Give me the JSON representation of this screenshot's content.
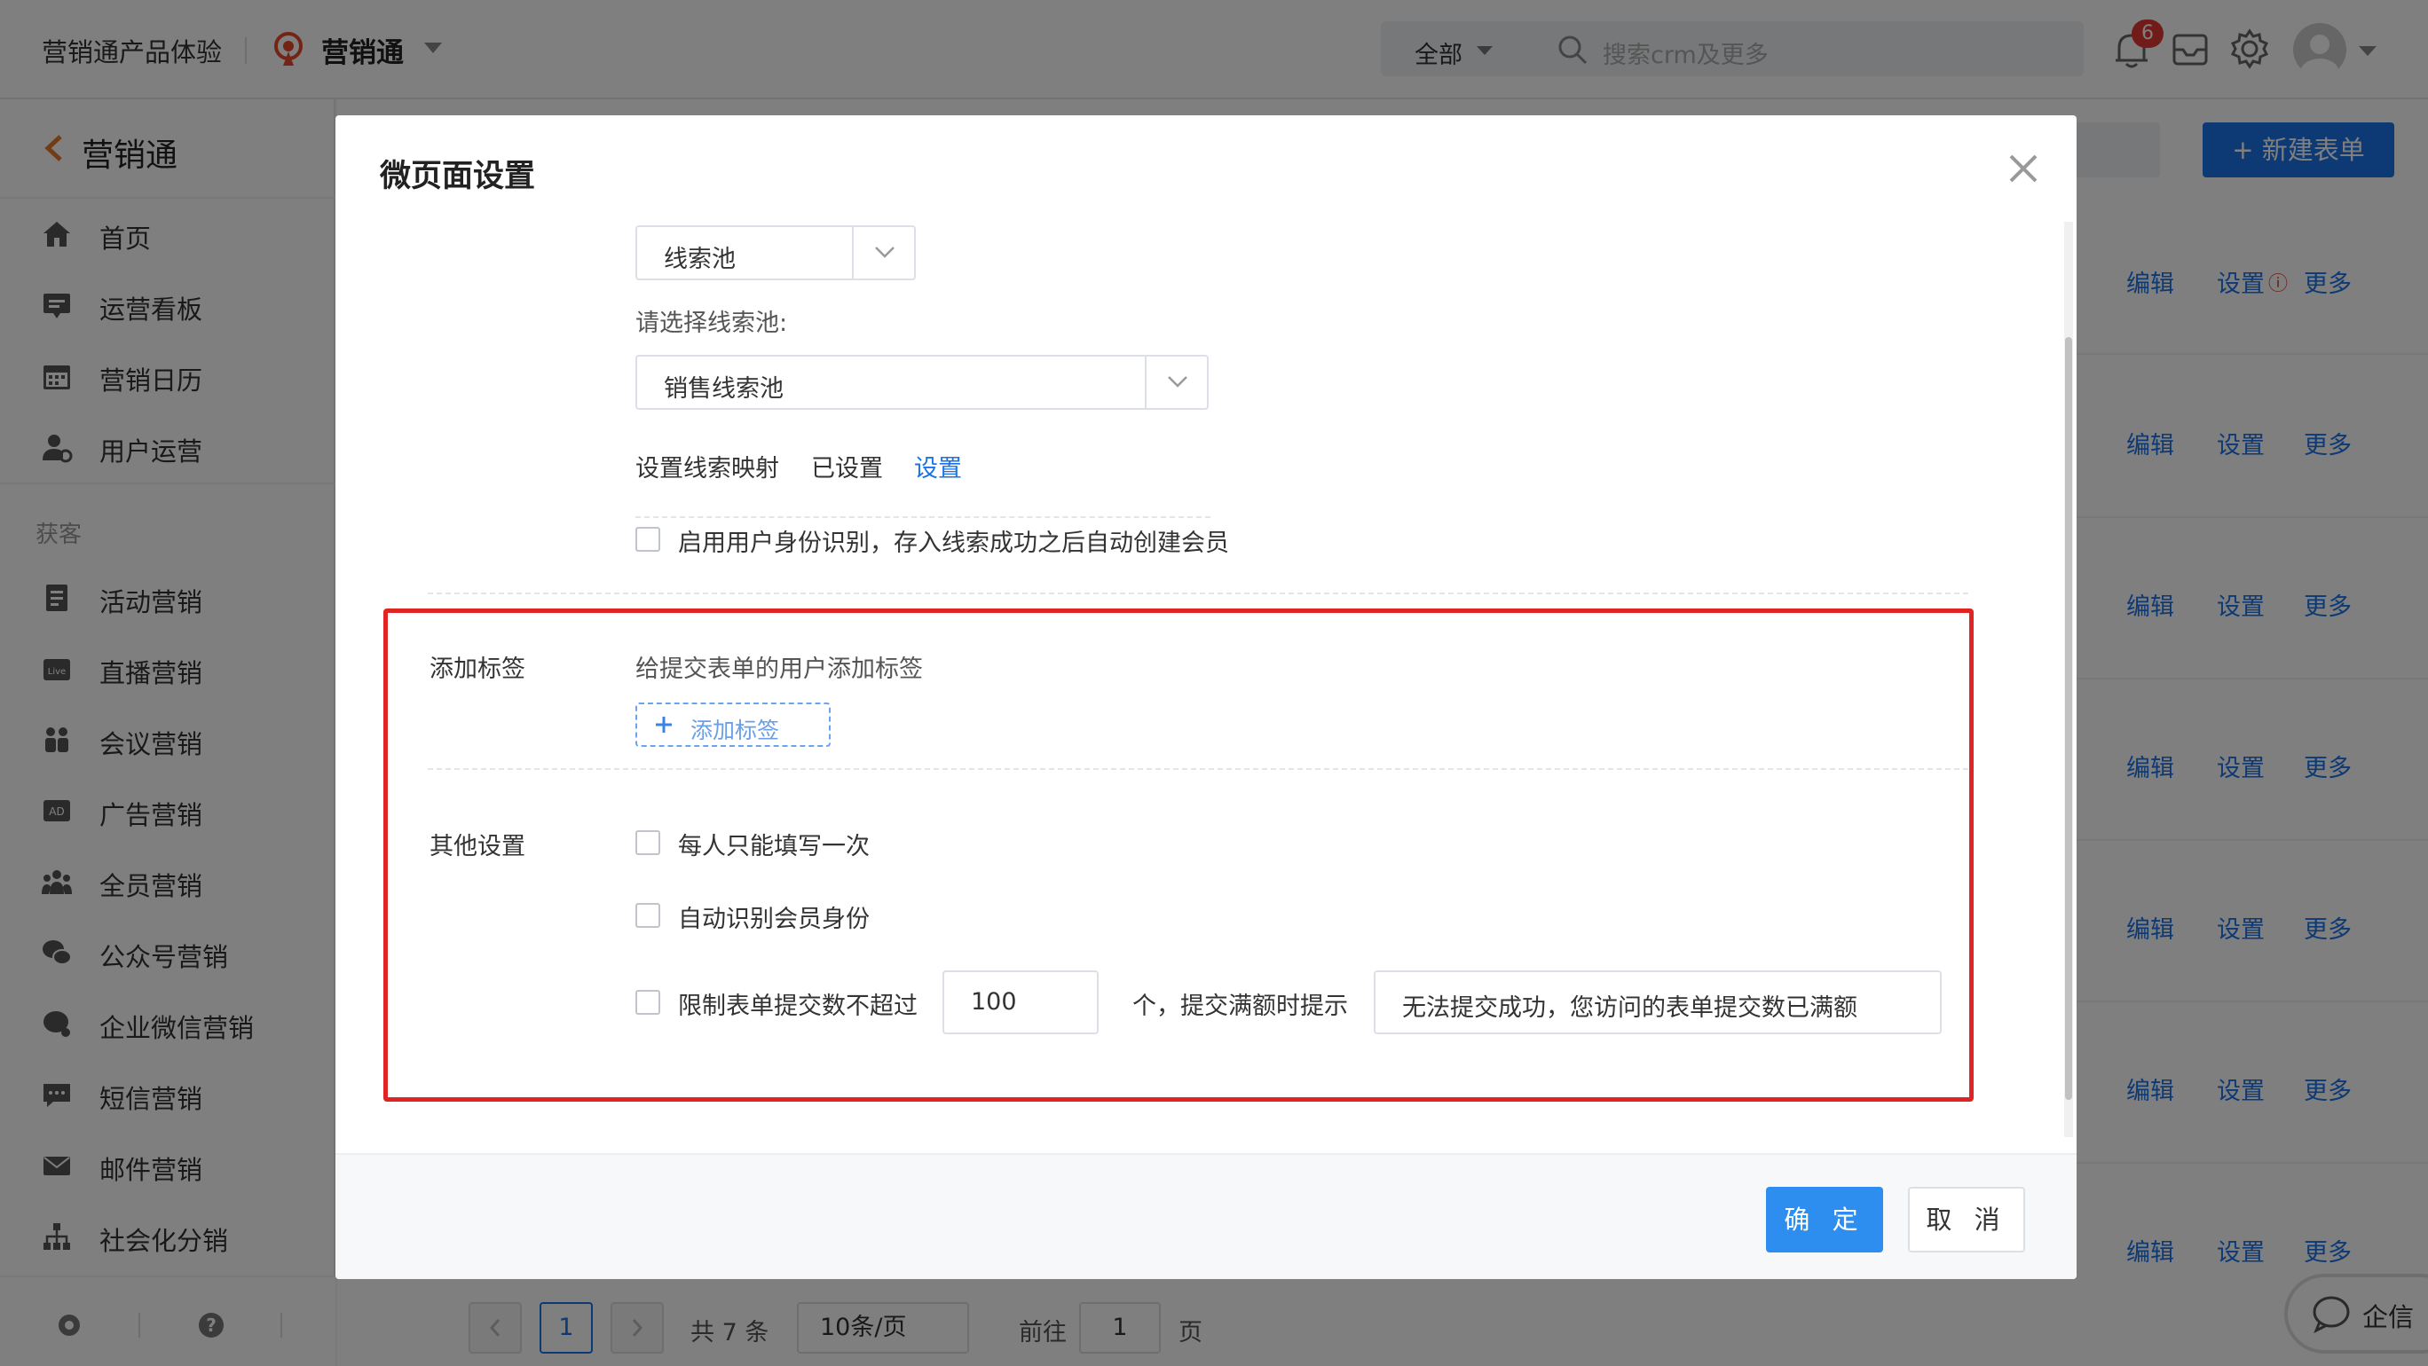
{
  "topbar": {
    "brand": "营销通产品体验",
    "app_title": "营销通",
    "search_scope": "全部",
    "search_placeholder": "搜索crm及更多",
    "notification_count": "6"
  },
  "sidebar": {
    "title": "营销通",
    "items_top": [
      {
        "label": "首页",
        "icon": "home-icon"
      },
      {
        "label": "运营看板",
        "icon": "dashboard-icon"
      },
      {
        "label": "营销日历",
        "icon": "calendar-icon"
      },
      {
        "label": "用户运营",
        "icon": "user-ops-icon"
      }
    ],
    "section_label": "获客",
    "items_acq": [
      {
        "label": "活动营销",
        "icon": "activity-icon"
      },
      {
        "label": "直播营销",
        "icon": "live-icon"
      },
      {
        "label": "会议营销",
        "icon": "meeting-icon"
      },
      {
        "label": "广告营销",
        "icon": "ad-icon"
      },
      {
        "label": "全员营销",
        "icon": "team-icon"
      },
      {
        "label": "公众号营销",
        "icon": "wechat-icon"
      },
      {
        "label": "企业微信营销",
        "icon": "wecom-icon"
      },
      {
        "label": "短信营销",
        "icon": "sms-icon"
      },
      {
        "label": "邮件营销",
        "icon": "mail-icon"
      },
      {
        "label": "社会化分销",
        "icon": "distribution-icon"
      }
    ]
  },
  "background": {
    "new_form_button": "新建表单",
    "row_actions": {
      "edit": "编辑",
      "settings": "设置",
      "more": "更多"
    },
    "pagination": {
      "current_page": "1",
      "total": "共 7 条",
      "page_size": "10条/页",
      "goto_label": "前往",
      "goto_value": "1",
      "page_suffix": "页"
    },
    "chat_label": "企信"
  },
  "modal": {
    "title": "微页面设置",
    "pool_type_select": "线索池",
    "pool_select_label": "请选择线索池:",
    "pool_select_value": "销售线索池",
    "mapping_label": "设置线索映射",
    "mapping_status": "已设置",
    "mapping_link": "设置",
    "identity_checkbox_label": "启用用户身份识别，存入线索成功之后自动创建会员",
    "tags_section_label": "添加标签",
    "tags_hint": "给提交表单的用户添加标签",
    "add_tag_button": "添加标签",
    "other_section_label": "其他设置",
    "once_per_person_label": "每人只能填写一次",
    "auto_member_label": "自动识别会员身份",
    "limit_label": "限制表单提交数不超过",
    "limit_value": "100",
    "limit_suffix": "个，提交满额时提示",
    "limit_message": "无法提交成功，您访问的表单提交数已满额",
    "ok_button": "确 定",
    "cancel_button": "取 消"
  },
  "colors": {
    "accent": "#1a73e8",
    "highlight_border": "#e02424",
    "badge": "#e53935"
  }
}
